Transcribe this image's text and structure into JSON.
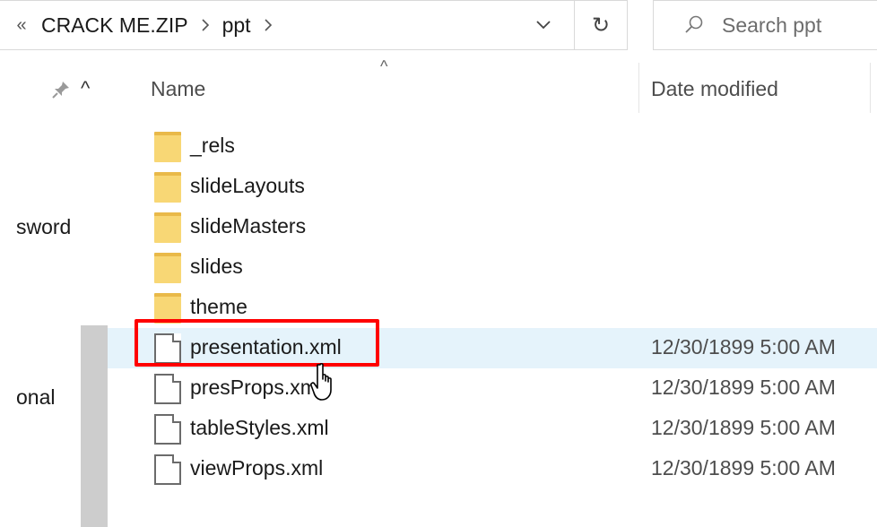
{
  "address_bar": {
    "overflow_glyph": "«",
    "crumbs": [
      {
        "label": "CRACK ME.ZIP"
      },
      {
        "label": "ppt"
      }
    ]
  },
  "search": {
    "placeholder": "Search ppt"
  },
  "nav": {
    "items": [
      {
        "label": "sword"
      },
      {
        "label": "onal"
      }
    ]
  },
  "columns": {
    "name": "Name",
    "date_modified": "Date modified"
  },
  "files": [
    {
      "name": "_rels",
      "type": "folder",
      "date": ""
    },
    {
      "name": "slideLayouts",
      "type": "folder",
      "date": ""
    },
    {
      "name": "slideMasters",
      "type": "folder",
      "date": ""
    },
    {
      "name": "slides",
      "type": "folder",
      "date": ""
    },
    {
      "name": "theme",
      "type": "folder",
      "date": ""
    },
    {
      "name": "presentation.xml",
      "type": "file",
      "date": "12/30/1899 5:00 AM",
      "highlighted": true
    },
    {
      "name": "presProps.xml",
      "type": "file",
      "date": "12/30/1899 5:00 AM"
    },
    {
      "name": "tableStyles.xml",
      "type": "file",
      "date": "12/30/1899 5:00 AM"
    },
    {
      "name": "viewProps.xml",
      "type": "file",
      "date": "12/30/1899 5:00 AM"
    }
  ],
  "colors": {
    "highlight": "#ff0000",
    "folder": "#f8d775",
    "hover_row": "#e5f3fb"
  }
}
